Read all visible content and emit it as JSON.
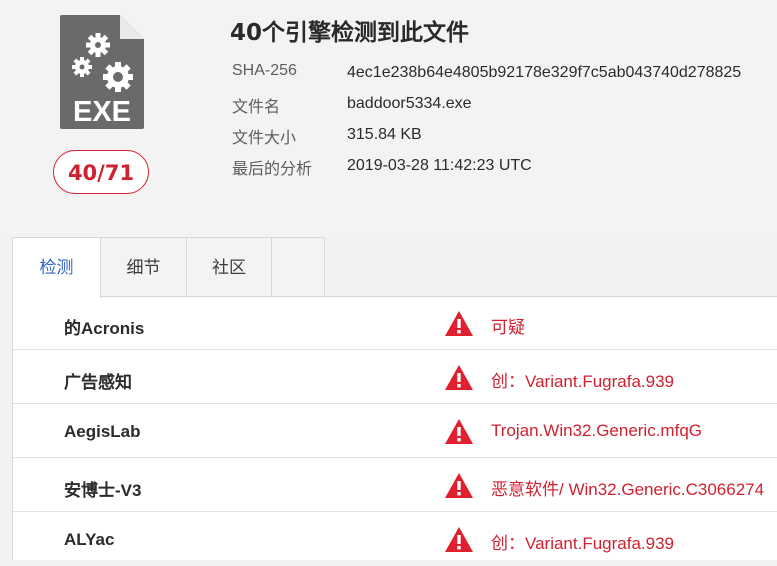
{
  "file": {
    "icon": "exe-file-icon",
    "icon_text": "EXE",
    "score": "40/71",
    "title": "40个引擎检测到此文件"
  },
  "meta": [
    {
      "label": "SHA-256",
      "value": "4ec1e238b64e4805b92178e329f7c5ab043740d278825"
    },
    {
      "label": "文件名",
      "value": "baddoor5334.exe"
    },
    {
      "label": "文件大小",
      "value": "315.84 KB"
    },
    {
      "label": "最后的分析",
      "value": "2019-03-28 11:42:23 UTC"
    }
  ],
  "tabs": [
    {
      "label": "检测",
      "active": true
    },
    {
      "label": "细节",
      "active": false
    },
    {
      "label": "社区",
      "active": false
    },
    {
      "label": "",
      "active": false
    }
  ],
  "detections": [
    {
      "engine": "的Acronis",
      "result": "可疑"
    },
    {
      "engine": "广告感知",
      "result": "创：Variant.Fugrafa.939"
    },
    {
      "engine": "AegisLab",
      "result": "Trojan.Win32.Generic.mfqG"
    },
    {
      "engine": "安博士-V3",
      "result": "恶意软件/ Win32.Generic.C3066274"
    },
    {
      "engine": "ALYac",
      "result": "创：Variant.Fugrafa.939"
    }
  ],
  "colors": {
    "detected": "#d02130",
    "active_tab": "#3366cc",
    "icon": "#6a6a6a"
  }
}
